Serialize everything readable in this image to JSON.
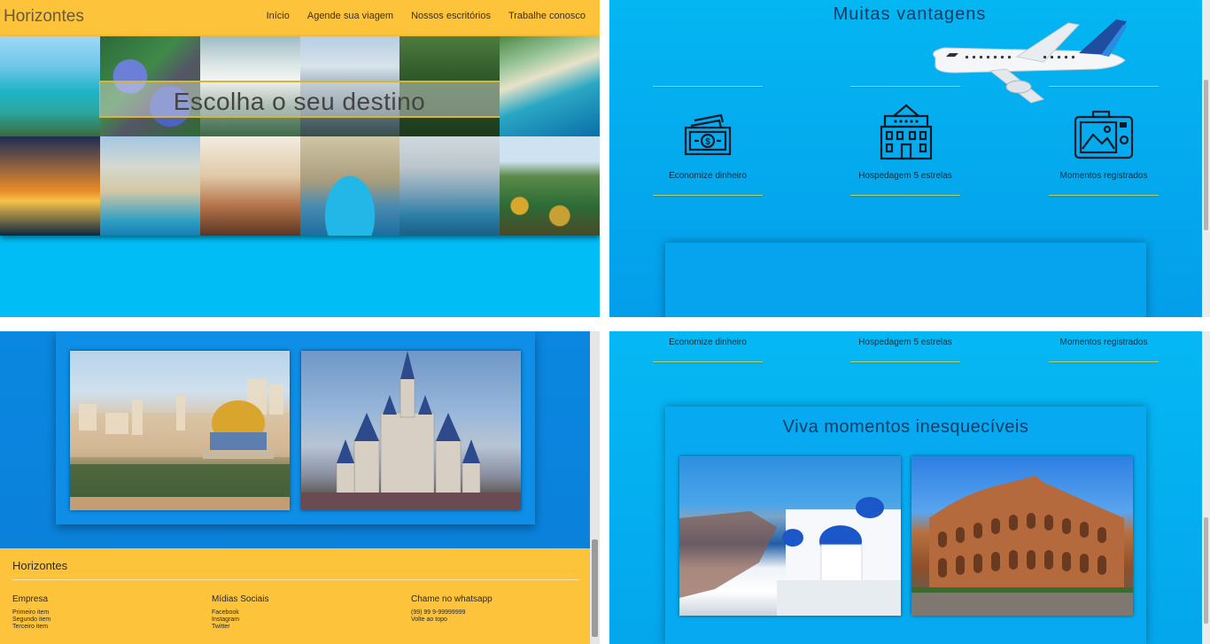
{
  "panel1": {
    "brand": "Horizontes",
    "nav": [
      "Início",
      "Agende sua viagem",
      "Nossos escritórios",
      "Trabalhe conosco"
    ],
    "banner_text": "Escolha o seu destino"
  },
  "panel2": {
    "title": "Muitas vantagens",
    "advantages": [
      {
        "label": "Economize dinheiro",
        "icon": "money-icon"
      },
      {
        "label": "Hospedagem 5 estrelas",
        "icon": "hotel-icon"
      },
      {
        "label": "Momentos registrados",
        "icon": "camera-icon"
      }
    ]
  },
  "panel3": {
    "footer": {
      "brand": "Horizontes",
      "columns": [
        {
          "heading": "Empresa",
          "items": [
            "Primeiro item",
            "Segundo item",
            "Terceiro item"
          ]
        },
        {
          "heading": "Mídias Sociais",
          "items": [
            "Facebook",
            "Instagram",
            "Twitter"
          ]
        },
        {
          "heading": "Chame no whatsapp",
          "items": [
            "(99) 99 9-99999999",
            "Volte ao topo"
          ]
        }
      ]
    }
  },
  "panel4": {
    "advantages": [
      "Economize dinheiro",
      "Hospedagem 5 estrelas",
      "Momentos registrados"
    ],
    "memories_title": "Viva momentos inesquecíveis"
  },
  "colors": {
    "header_yellow": "#fdc33a",
    "sky_blue": "#00bdf6",
    "deep_blue": "#0a87e0",
    "title_navy": "#0a3d66",
    "accent_rule": "#b7d26a"
  }
}
